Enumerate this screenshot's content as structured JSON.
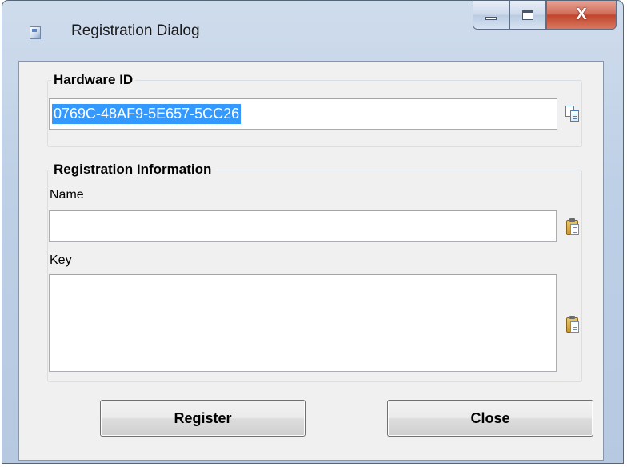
{
  "window": {
    "title": "Registration Dialog",
    "minimize_icon": "minimize-icon",
    "maximize_icon": "maximize-icon",
    "close_glyph": "X"
  },
  "hardware": {
    "group_title": "Hardware ID",
    "value": "0769C-48AF9-5E657-5CC26",
    "copy_icon": "copy-icon"
  },
  "registration": {
    "group_title": "Registration Information",
    "name_label": "Name",
    "name_value": "",
    "key_label": "Key",
    "key_value": "",
    "paste_icon": "paste-icon"
  },
  "buttons": {
    "register": "Register",
    "close": "Close"
  }
}
